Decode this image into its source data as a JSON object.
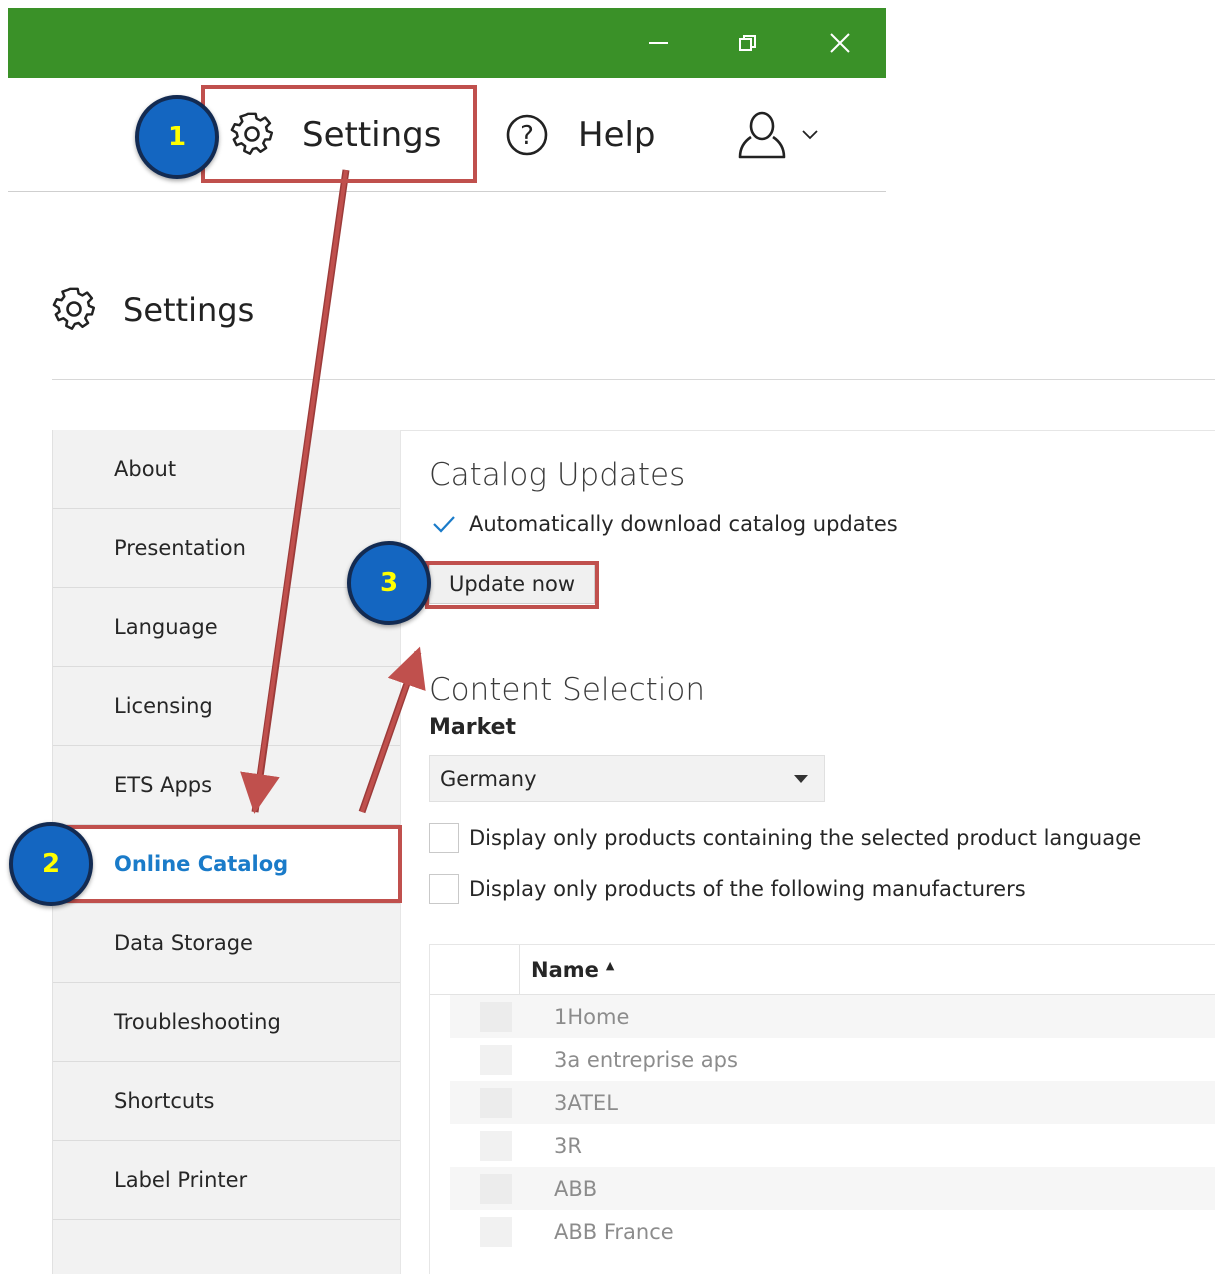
{
  "window": {
    "toolbar": {
      "settings_label": "Settings",
      "help_label": "Help"
    }
  },
  "settings": {
    "title": "Settings",
    "sidebar": {
      "items": [
        {
          "label": "About"
        },
        {
          "label": "Presentation"
        },
        {
          "label": "Language"
        },
        {
          "label": "Licensing"
        },
        {
          "label": "ETS Apps"
        },
        {
          "label": "Online Catalog",
          "active": true
        },
        {
          "label": "Data Storage"
        },
        {
          "label": "Troubleshooting"
        },
        {
          "label": "Shortcuts"
        },
        {
          "label": "Label Printer"
        }
      ]
    },
    "catalog_updates": {
      "heading": "Catalog Updates",
      "auto_download_label": "Automatically download catalog updates",
      "auto_download_checked": true,
      "update_button_label": "Update now"
    },
    "content_selection": {
      "heading": "Content Selection",
      "market_label": "Market",
      "market_value": "Germany",
      "product_language_label": "Display only products containing the selected product language",
      "product_language_checked": false,
      "manufacturers_label": "Display only products of the following manufacturers",
      "manufacturers_checked": false,
      "table": {
        "name_header": "Name",
        "sort_indicator": "▲",
        "rows": [
          "1Home",
          "3a entreprise aps",
          "3ATEL",
          "3R",
          "ABB",
          "ABB France"
        ]
      }
    }
  },
  "annotations": {
    "step_1": "1",
    "step_2": "2",
    "step_3": "3",
    "highlight_color": "#c0504d",
    "badge_color": "#1466c1",
    "badge_text_color": "#ffff00"
  },
  "colors": {
    "titlebar": "#3a9128",
    "active_nav": "#1a7bc9",
    "checkmark": "#1a7bc9"
  }
}
